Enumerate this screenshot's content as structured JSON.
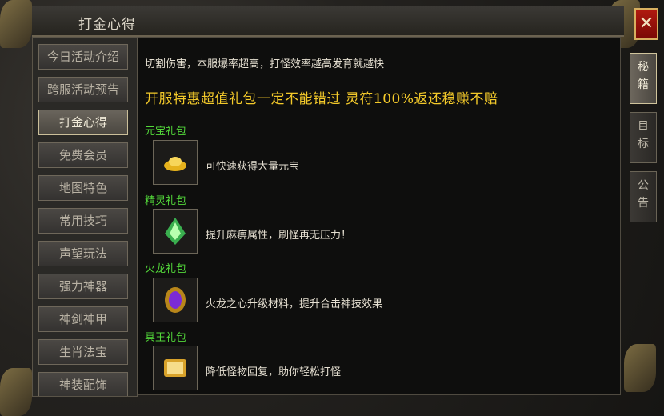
{
  "window": {
    "title": "打金心得",
    "close_label": "✕"
  },
  "sidebar": {
    "items": [
      {
        "label": "今日活动介绍",
        "active": false
      },
      {
        "label": "跨服活动预告",
        "active": false
      },
      {
        "label": "打金心得",
        "active": true
      },
      {
        "label": "免费会员",
        "active": false
      },
      {
        "label": "地图特色",
        "active": false
      },
      {
        "label": "常用技巧",
        "active": false
      },
      {
        "label": "声望玩法",
        "active": false
      },
      {
        "label": "强力神器",
        "active": false
      },
      {
        "label": "神剑神甲",
        "active": false
      },
      {
        "label": "生肖法宝",
        "active": false
      },
      {
        "label": "神装配饰",
        "active": false
      }
    ]
  },
  "content": {
    "intro": "切割伤害，本服爆率超高，打怪效率越高发育就越快",
    "headline": "开服特惠超值礼包一定不能错过  灵符100%返还稳赚不赔",
    "packs": [
      {
        "title": "元宝礼包",
        "icon": "gold-ingot-icon",
        "description": "可快速获得大量元宝"
      },
      {
        "title": "精灵礼包",
        "icon": "green-spirit-icon",
        "description": "提升麻痹属性，刷怪再无压力！"
      },
      {
        "title": "火龙礼包",
        "icon": "fire-dragon-heart-icon",
        "description": "火龙之心升级材料，提升合击神技效果"
      },
      {
        "title": "冥王礼包",
        "icon": "underworld-scroll-icon",
        "description": "降低怪物回复，助你轻松打怪"
      }
    ]
  },
  "right_tabs": [
    {
      "chars": [
        "秘",
        "籍"
      ],
      "active": true
    },
    {
      "chars": [
        "目",
        "标"
      ],
      "active": false
    },
    {
      "chars": [
        "公",
        "告"
      ],
      "active": false
    }
  ],
  "colors": {
    "accent_gold": "#f3c92a",
    "pack_green": "#53d83a",
    "close_red": "#b01a10"
  }
}
